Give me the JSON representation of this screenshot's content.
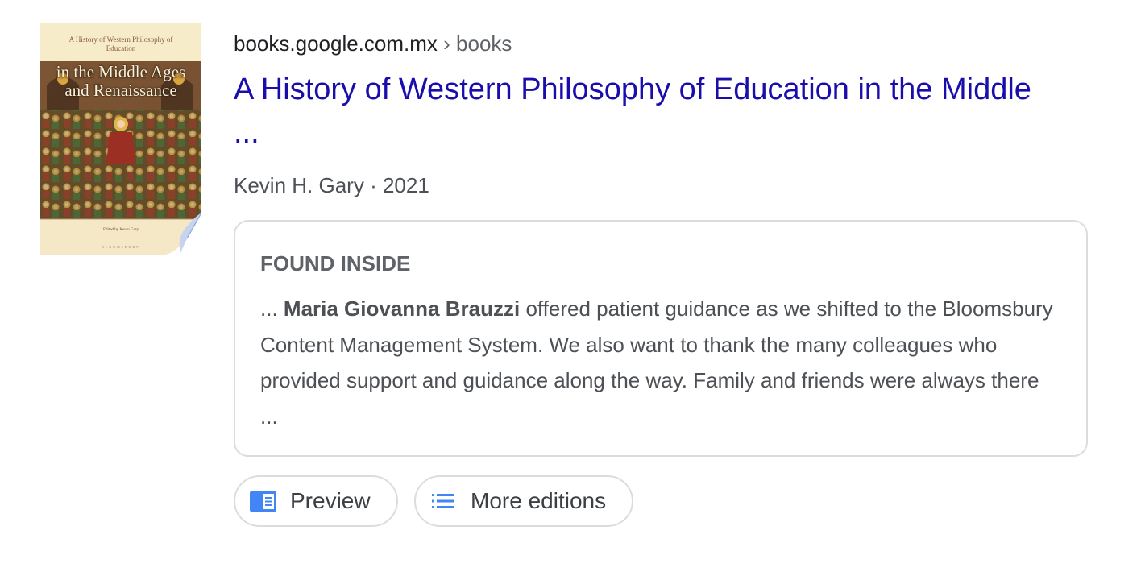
{
  "cover": {
    "top_text": "A History of Western Philosophy of Education",
    "title_text": "in the Middle Ages and Renaissance",
    "editor_text": "Edited by Kevin Gary",
    "publisher_text": "BLOOMSBURY"
  },
  "result": {
    "breadcrumb": {
      "domain": "books.google.com.mx",
      "separator": "›",
      "path": "books"
    },
    "title_line1": "A History of Western Philosophy of Education in the Middle",
    "title_line2": "...",
    "author": "Kevin H. Gary",
    "meta_separator": "·",
    "year": "2021"
  },
  "found_inside": {
    "heading": "FOUND INSIDE",
    "snippet_prefix": "... ",
    "snippet_bold": "Maria Giovanna Brauzzi",
    "snippet_rest": " offered patient guidance as we shifted to the Bloomsbury Content Management System. We also want to thank the many colleagues who provided support and guidance along the way. Family and friends were always there ..."
  },
  "buttons": {
    "preview_label": "Preview",
    "preview_icon": "book-preview-icon",
    "more_editions_label": "More editions",
    "more_editions_icon": "list-icon"
  },
  "colors": {
    "link": "#1a0dab",
    "text": "#4d5156",
    "border": "#dadce0",
    "icon_blue": "#4285f4"
  }
}
